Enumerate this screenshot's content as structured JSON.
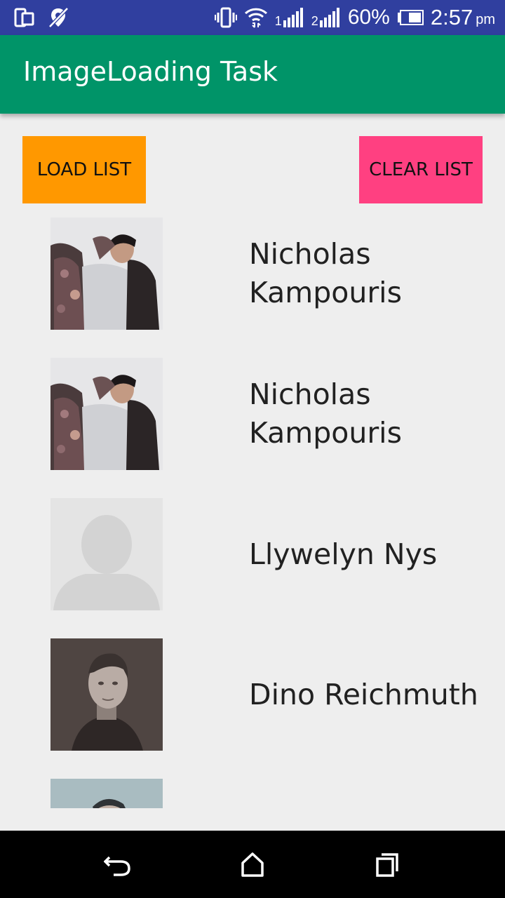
{
  "status_bar": {
    "battery_percent": "60%",
    "time": "2:57",
    "ampm": "pm",
    "sim1_label": "1",
    "sim2_label": "2",
    "icons": [
      "device-icon",
      "location-off-icon",
      "vibrate-icon",
      "wifi-icon",
      "signal-sim1-icon",
      "signal-sim2-icon",
      "battery-icon"
    ]
  },
  "app_bar": {
    "title": "ImageLoading Task",
    "color": "#009468"
  },
  "buttons": {
    "load_label": "LOAD LIST",
    "load_color": "#ff9800",
    "clear_label": "CLEAR LIST",
    "clear_color": "#ff4081"
  },
  "list": {
    "items": [
      {
        "name": "Nicholas Kampouris",
        "photo": "person-photo-jacket"
      },
      {
        "name": "Nicholas Kampouris",
        "photo": "person-photo-jacket"
      },
      {
        "name": "Llywelyn Nys",
        "photo": "placeholder-avatar"
      },
      {
        "name": "Dino Reichmuth",
        "photo": "person-photo-portrait"
      },
      {
        "name": "",
        "photo": "person-photo-partial"
      }
    ]
  },
  "nav_bar": {
    "icons": [
      "back-icon",
      "home-icon",
      "recents-icon"
    ]
  }
}
